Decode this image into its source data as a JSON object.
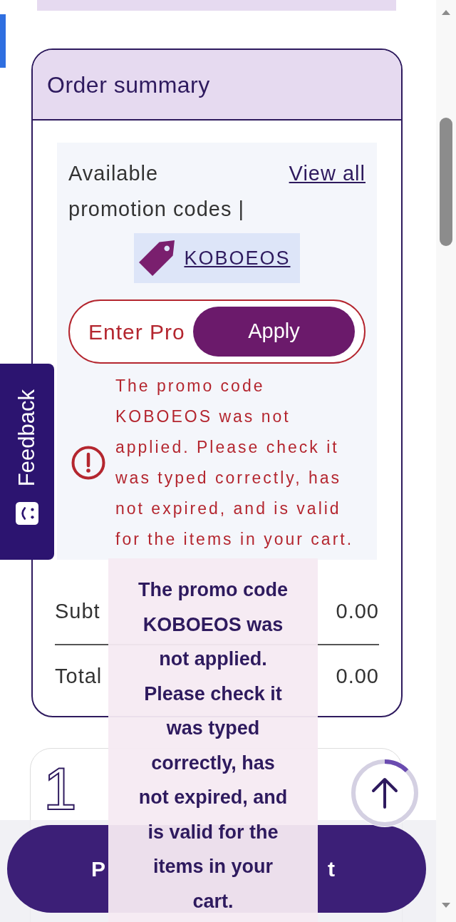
{
  "order_summary": {
    "title": "Order summary",
    "promotions": {
      "label": "Available promotion codes |",
      "view_all": "View all",
      "codes": [
        {
          "code": "KOBOEOS"
        }
      ]
    },
    "promo_input": {
      "placeholder": "Enter Pro",
      "button": "Apply",
      "error": true
    },
    "error_message": "The promo code KOBOEOS was not applied. Please check it was typed correctly, has not expired, and is valid for the items in your cart.",
    "totals": [
      {
        "label": "Subt",
        "value": "0.00"
      },
      {
        "label": "Total",
        "value": "0.00"
      }
    ]
  },
  "feedback_tab": {
    "label": "Feedback"
  },
  "cart_item": {
    "number": "1"
  },
  "tooltip": {
    "text": "The promo code KOBOEOS was not applied. Please check it was typed correctly, has not expired, and is valid for the items in your cart."
  },
  "checkout_bar": {
    "button": {
      "visible_text": [
        "P",
        "t"
      ]
    }
  }
}
